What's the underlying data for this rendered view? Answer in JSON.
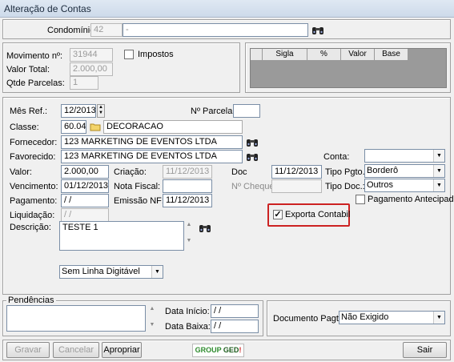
{
  "window": {
    "title": "Alteração de Contas"
  },
  "header": {
    "condominio_label": "Condomínio:",
    "condominio_code": "42",
    "condominio_name": "-"
  },
  "movimento": {
    "label": "Movimento nº:",
    "value": "31944",
    "impostos_label": "Impostos",
    "valor_total_label": "Valor Total:",
    "valor_total": "2.000,00",
    "qtde_parcelas_label": "Qtde Parcelas:",
    "qtde_parcelas": "1"
  },
  "taxes_grid": {
    "columns": [
      "Sigla",
      "%",
      "Valor",
      "Base"
    ]
  },
  "form": {
    "mes_ref_label": "Mês Ref.:",
    "mes_ref": "12/2013",
    "nparcela_label": "Nº Parcela:",
    "nparcela": "",
    "classe_label": "Classe:",
    "classe_code": "60.04",
    "classe_name": "DECORACAO",
    "fornecedor_label": "Fornecedor:",
    "fornecedor": "123 MARKETING DE EVENTOS LTDA",
    "favorecido_label": "Favorecido:",
    "favorecido": "123 MARKETING DE EVENTOS LTDA",
    "conta_label": "Conta:",
    "conta": "",
    "valor_label": "Valor:",
    "valor": "2.000,00",
    "criacao_label": "Criação:",
    "criacao": "11/12/2013",
    "doc_label": "Doc",
    "doc": "11/12/2013",
    "tipo_pgto_label": "Tipo Pgto.:",
    "tipo_pgto": "Borderô",
    "vencimento_label": "Vencimento:",
    "vencimento": "01/12/2013",
    "nota_fiscal_label": "Nota Fiscal:",
    "nota_fiscal": "",
    "ncheque_label": "Nº Cheque:",
    "ncheque": "",
    "tipo_doc_label": "Tipo Doc.:",
    "tipo_doc": "Outros",
    "pagamento_label": "Pagamento:",
    "pagamento": " / /",
    "emissao_nf_label": "Emissão NF:",
    "emissao_nf": "11/12/2013",
    "pagamento_antecipado_label": "Pagamento Antecipado",
    "liquidacao_label": "Liquidação:",
    "liquidacao": " / /",
    "exporta_contabil_label": "Exporta Contabil",
    "descricao_label": "Descrição:",
    "descricao": "TESTE 1",
    "linha_digitavel": "Sem Linha Digitável"
  },
  "pendencias": {
    "label": "Pendências",
    "data_inicio_label": "Data Início:",
    "data_inicio": " / /",
    "data_baixa_label": "Data Baixa:",
    "data_baixa": " / /",
    "doc_pagto_label": "Documento Pagto:",
    "doc_pagto": "Não Exigido"
  },
  "footer": {
    "gravar": "Gravar",
    "cancelar": "Cancelar",
    "apropriar": "Apropriar",
    "logo_group": "GROUP",
    "logo_ged": "GED",
    "sair": "Sair"
  },
  "colors": {
    "highlight": "#cc2222",
    "ged": "#2e8b2e"
  },
  "icons": {
    "search": "binoculars-icon",
    "folder": "folder-icon"
  }
}
